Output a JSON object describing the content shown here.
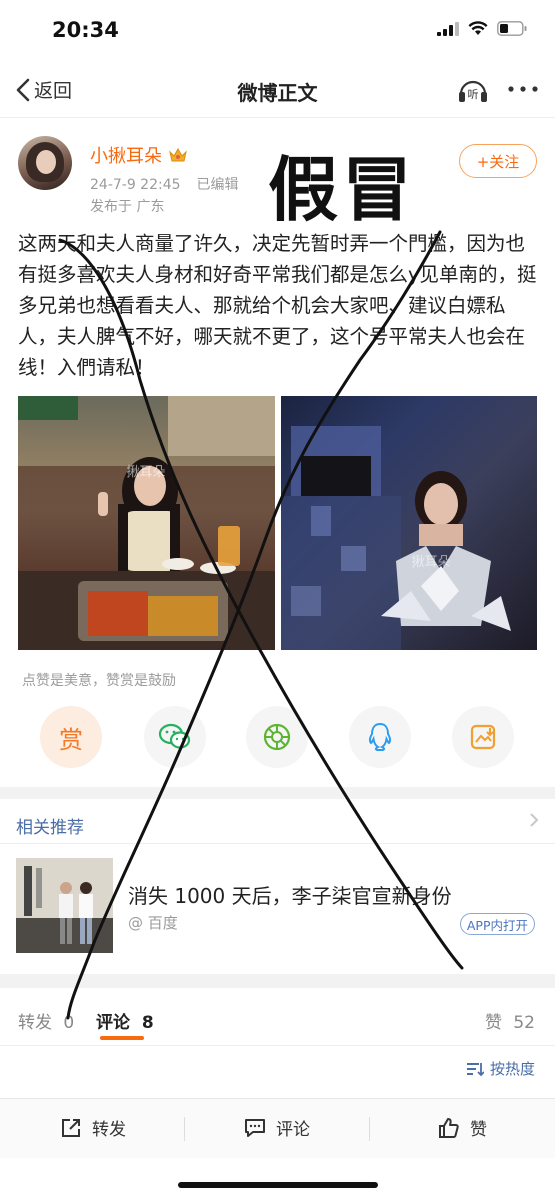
{
  "status_bar": {
    "time": "20:34"
  },
  "nav": {
    "back_label": "返回",
    "title": "微博正文",
    "listen_label": "听"
  },
  "post": {
    "username": "小揪耳朵",
    "date": "24-7-9 22:45",
    "edited": "已编辑",
    "location": "发布于 广东",
    "follow_label": "+关注",
    "text": "这两天和夫人商量了许久，决定先暂时弄一个門檻，因为也有挺多喜欢夫人身材和好奇平常我们都是怎么y见单南的，挺多兄弟也想看看夫人、那就给个机会大家吧、建议白嫖私人，夫人脾气不好，哪天就不更了，这个号平常夫人也会在线！入們请私！",
    "watermark": "揪耳朵"
  },
  "annotation": {
    "stamp": "假冒"
  },
  "reward": {
    "hint": "点赞是美意，赞赏是鼓励",
    "reward_glyph": "赏"
  },
  "share_icons": [
    "reward-icon",
    "wechat-icon",
    "moments-icon",
    "qq-icon",
    "save-image-icon"
  ],
  "related": {
    "title": "相关推荐",
    "headline": "消失 1000 天后，李子柒官宣新身份",
    "source": "@ 百度",
    "open_app": "APP内打开"
  },
  "tabs": {
    "repost": {
      "label": "转发",
      "count": "0"
    },
    "comment": {
      "label": "评论",
      "count": "8"
    },
    "like": {
      "label": "赞",
      "count": "52"
    }
  },
  "sort": {
    "label": "按热度"
  },
  "bottom_bar": {
    "repost": "转发",
    "comment": "评论",
    "like": "赞"
  },
  "colors": {
    "accent": "#f86a0f",
    "link": "#4a6ea8"
  }
}
